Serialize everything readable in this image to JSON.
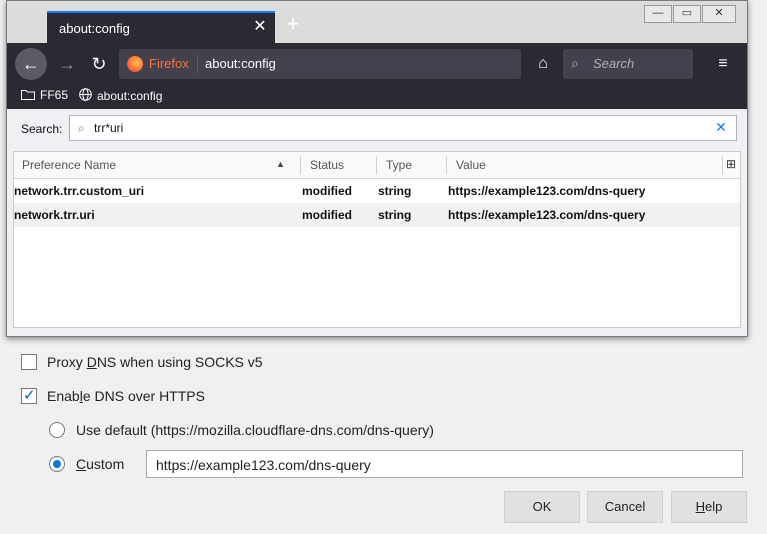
{
  "browser": {
    "tab_title": "about:config",
    "tab_close_glyph": "✕",
    "new_tab_glyph": "+",
    "window_controls": [
      "—",
      "▭",
      "✕"
    ],
    "nav": {
      "back_glyph": "←",
      "forward_glyph": "→",
      "reload_glyph": "↻"
    },
    "identity_label": "Firefox",
    "url": "about:config",
    "home_glyph": "⌂",
    "search_glyph": "⌕",
    "search_placeholder": "Search",
    "menu_glyph": "≡",
    "bookmarks": [
      {
        "label": "FF65",
        "icon": "folder-icon"
      },
      {
        "label": "about:config",
        "icon": "globe-icon"
      }
    ]
  },
  "config": {
    "search_label": "Search:",
    "search_icon": "⌕",
    "search_value": "trr*uri",
    "clear_glyph": "✕",
    "columns": [
      "Preference Name",
      "Status",
      "Type",
      "Value"
    ],
    "sort_glyph": "▲",
    "column_picker_glyph": "⊞",
    "rows": [
      {
        "name": "network.trr.custom_uri",
        "status": "modified",
        "type": "string",
        "value": "https://example123.com/dns-query"
      },
      {
        "name": "network.trr.uri",
        "status": "modified",
        "type": "string",
        "value": "https://example123.com/dns-query"
      }
    ]
  },
  "dialog": {
    "proxy_dns_label_pre": "Proxy ",
    "proxy_dns_label_accel": "D",
    "proxy_dns_label_post": "NS when using SOCKS v5",
    "proxy_dns_checked": false,
    "doh_label_pre": "Enab",
    "doh_label_accel": "l",
    "doh_label_post": "e DNS over HTTPS",
    "doh_checked": true,
    "use_default_label": "Use default (https://mozilla.cloudflare-dns.com/dns-query)",
    "custom_label_accel": "C",
    "custom_label_post": "ustom",
    "custom_value": "https://example123.com/dns-query",
    "selected": "custom",
    "ok_label": "OK",
    "cancel_label": "Cancel",
    "help_label_accel": "H",
    "help_label_post": "elp"
  },
  "colors": {
    "accent": "#0a84ff",
    "toolbar": "#2b2a33",
    "radio_selected": "#0078d7"
  }
}
